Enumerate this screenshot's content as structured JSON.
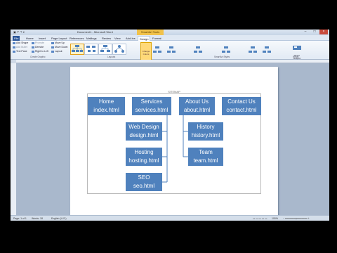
{
  "window": {
    "title": "Document1 - Microsoft Word",
    "contextual_tab_group": "SmartArt Tools",
    "controls": {
      "minimize": "–",
      "maximize": "□",
      "close": "×"
    }
  },
  "ribbon_tabs": [
    {
      "label": "File",
      "kind": "file"
    },
    {
      "label": "Home"
    },
    {
      "label": "Insert"
    },
    {
      "label": "Page Layout"
    },
    {
      "label": "References"
    },
    {
      "label": "Mailings"
    },
    {
      "label": "Review"
    },
    {
      "label": "View"
    },
    {
      "label": "Add-Ins"
    },
    {
      "label": "Design",
      "kind": "active"
    },
    {
      "label": "Format"
    }
  ],
  "ribbon": {
    "create_graphic": {
      "commands": [
        "Add Shape",
        "Add Bullet",
        "Text Pane",
        "Promote",
        "Demote",
        "Right to Left",
        "Move Up",
        "Move Down",
        "Layout"
      ],
      "group_label": "Create Graphic"
    },
    "layouts": {
      "group_label": "Layouts"
    },
    "change_colors_label": "Change Colors",
    "smartart_styles": {
      "group_label": "SmartArt Styles"
    },
    "reset": {
      "label": "Reset Graphic",
      "group_label": "Reset"
    }
  },
  "smartart": {
    "label": "SITEMAP",
    "nodes": {
      "home": {
        "title": "Home",
        "file": "index.html"
      },
      "services": {
        "title": "Services",
        "file": "services.html"
      },
      "about": {
        "title": "About Us",
        "file": "about.html"
      },
      "contact": {
        "title": "Contact Us",
        "file": "contact.html"
      },
      "webdesign": {
        "title": "Web Design",
        "file": "design.html"
      },
      "hosting": {
        "title": "Hosting",
        "file": "hosting.html"
      },
      "seo": {
        "title": "SEO",
        "file": "seo.html"
      },
      "history": {
        "title": "History",
        "file": "history.html"
      },
      "team": {
        "title": "Team",
        "file": "team.html"
      }
    }
  },
  "statusbar": {
    "page": "Page: 1 of 1",
    "words": "Words: 18",
    "language": "English (U.S.)",
    "zoom": "100%"
  },
  "colors": {
    "node_fill": "#4f81bd",
    "ribbon_accent": "#2b579a",
    "context_tab": "#f1c24a"
  }
}
